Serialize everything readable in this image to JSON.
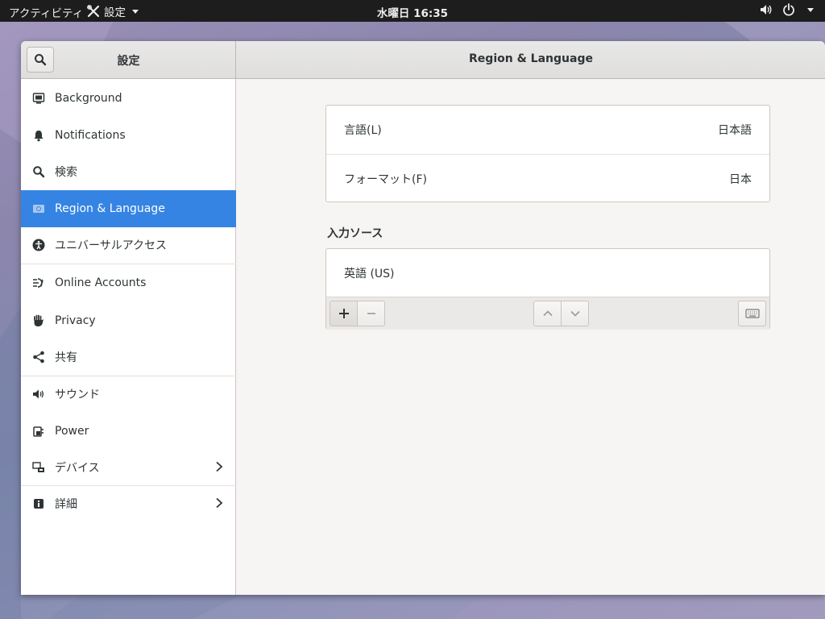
{
  "topbar": {
    "activities": "アクティビティ",
    "app_menu": "設定",
    "clock": "水曜日 16:35"
  },
  "window": {
    "sidebar_title": "設定",
    "panel_title": "Region & Language"
  },
  "sidebar": {
    "items": [
      {
        "label": "Background",
        "icon": "background-icon"
      },
      {
        "label": "Notifications",
        "icon": "bell-icon"
      },
      {
        "label": "検索",
        "icon": "search-icon"
      },
      {
        "label": "Region & Language",
        "icon": "flag-icon"
      },
      {
        "label": "ユニバーサルアクセス",
        "icon": "accessibility-icon"
      },
      {
        "label": "Online Accounts",
        "icon": "online-accounts-icon"
      },
      {
        "label": "Privacy",
        "icon": "hand-icon"
      },
      {
        "label": "共有",
        "icon": "share-icon"
      },
      {
        "label": "サウンド",
        "icon": "speaker-icon"
      },
      {
        "label": "Power",
        "icon": "power-plug-icon"
      },
      {
        "label": "デバイス",
        "icon": "devices-icon"
      },
      {
        "label": "詳細",
        "icon": "info-icon"
      }
    ]
  },
  "region": {
    "language_label": "言語(L)",
    "language_value": "日本語",
    "format_label": "フォーマット(F)",
    "format_value": "日本",
    "input_sources_title": "入力ソース",
    "input_sources": [
      "英語 (US)"
    ]
  },
  "colors": {
    "accent": "#3584e4",
    "topbar": "#1d1d1d"
  }
}
